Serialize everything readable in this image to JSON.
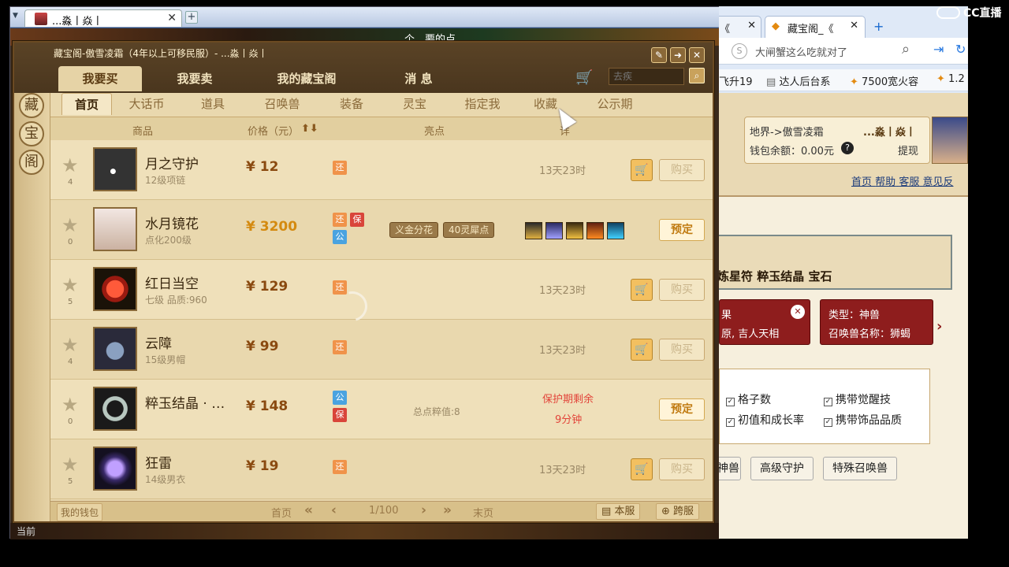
{
  "game_tab": {
    "title": "...淼丨焱丨"
  },
  "scene": {
    "top_text": "个，要的点",
    "bottom_text": "当前"
  },
  "dialog": {
    "title": "藏宝阁-傲雪凌霜（4年以上可移民服）- ...淼丨焱丨",
    "side_chars": [
      "藏",
      "宝",
      "阁"
    ],
    "main_tabs": [
      "我要买",
      "我要卖",
      "我的藏宝阁",
      "消 息"
    ],
    "search_placeholder": "去疾",
    "sub_tabs": [
      "首页",
      "大话币",
      "道具",
      "召唤兽",
      "装备",
      "灵宝",
      "指定我",
      "收藏",
      "公示期"
    ],
    "columns": {
      "goods": "商品",
      "price": "价格（元）",
      "highlights": "亮点",
      "details": "详"
    },
    "items": [
      {
        "name": "月之守护",
        "sub": "12级项链",
        "price": "¥ 12",
        "stars": "4",
        "detail": "13天23时",
        "buy": "购买"
      },
      {
        "name": "水月镜花",
        "sub": "点化200级",
        "price": "¥ 3200",
        "stars": "0",
        "tags": [
          "义金分花",
          "40灵犀点"
        ],
        "reserve": "预定"
      },
      {
        "name": "红日当空",
        "sub": "七级 品质:960",
        "price": "¥ 129",
        "stars": "5",
        "detail": "13天23时",
        "buy": "购买"
      },
      {
        "name": "云障",
        "sub": "15级男帽",
        "price": "¥ 99",
        "stars": "4",
        "detail": "13天23时",
        "buy": "购买"
      },
      {
        "name": "粹玉结晶 · 左⋯",
        "sub": "",
        "price": "¥ 148",
        "stars": "0",
        "highlight_text": "总点粹值:8",
        "protect_line1": "保护期剩余",
        "protect_line2": "9分钟",
        "reserve": "预定"
      },
      {
        "name": "狂雷",
        "sub": "14级男衣",
        "price": "¥ 19",
        "stars": "5",
        "detail": "13天23时",
        "buy": "购买"
      }
    ],
    "badges": {
      "huan": "还",
      "bao": "保",
      "gong": "公"
    },
    "footer": {
      "wallet": "我的钱包",
      "first": "首页",
      "page": "1/100",
      "last": "末页",
      "this_server": "本服",
      "cross_server": "跨服"
    }
  },
  "browser": {
    "tabs": [
      "《",
      "藏宝阁_《"
    ],
    "address": "大闸蟹这么吃就对了",
    "bookmarks": [
      "飞升19",
      "达人后台系",
      "7500宽火容",
      "1.2"
    ],
    "account": {
      "server": "地界->傲雪凌霜",
      "user": "...淼丨焱丨",
      "balance": "钱包余额：0.00元",
      "withdraw": "提现"
    },
    "links": [
      "首页",
      "帮助",
      "客服",
      "意见反"
    ],
    "filter_tags": "炼星符  粹玉结晶  宝石",
    "card1": {
      "line1": "果",
      "line2": "原, 吉人天相"
    },
    "card2": {
      "line1": "类型：神兽",
      "line2": "召唤兽名称：狮蝎"
    },
    "options": [
      "格子数",
      "携带觉醒技",
      "初值和成长率",
      "携带饰品品质"
    ],
    "pet_buttons": [
      "神兽",
      "高级守护",
      "特殊召唤兽"
    ]
  },
  "overlay": {
    "brand": "CC直播"
  },
  "colors": {
    "price_hot": "#d48a10",
    "reserve": "#c07a10",
    "protect": "#e2443a",
    "card": "#8e1d1d"
  }
}
